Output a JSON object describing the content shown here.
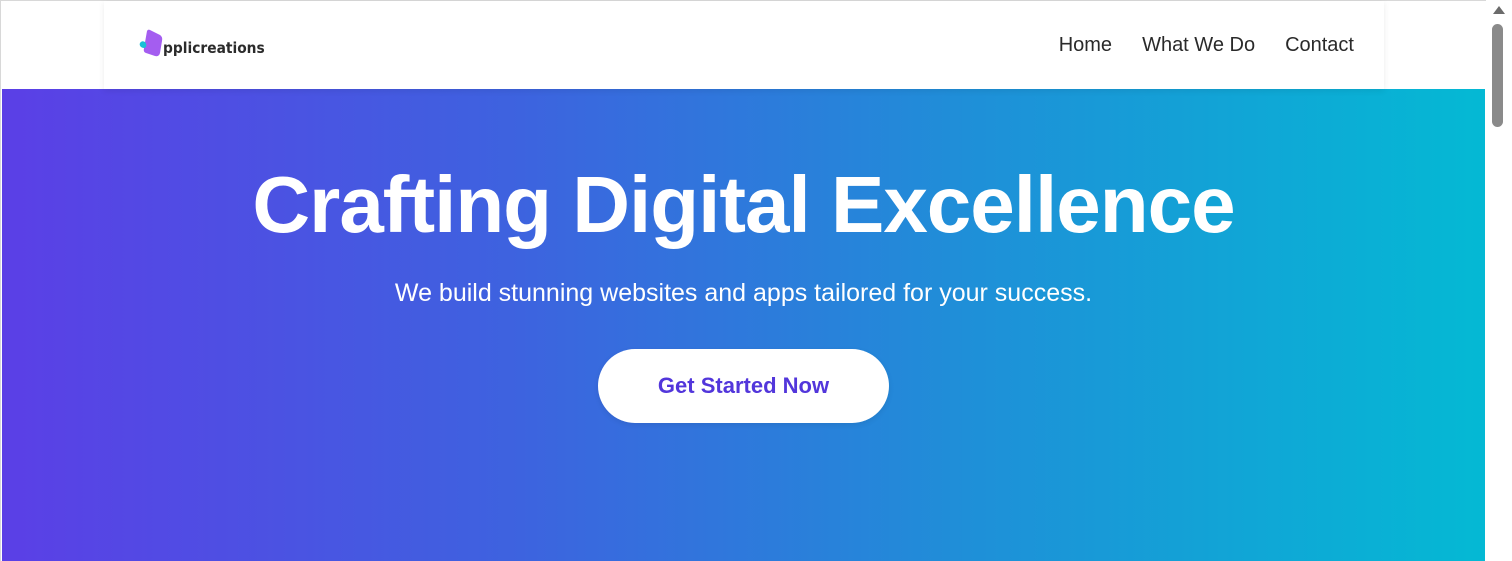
{
  "header": {
    "logo_text": "pplicreations",
    "nav": [
      {
        "label": "Home"
      },
      {
        "label": "What We Do"
      },
      {
        "label": "Contact"
      }
    ]
  },
  "hero": {
    "title": "Crafting Digital Excellence",
    "subtitle": "We build stunning websites and apps tailored for your success.",
    "cta_label": "Get Started Now"
  },
  "colors": {
    "gradient_start": "#5b3fe6",
    "gradient_end": "#04b9d4",
    "cta_text": "#5236db",
    "logo_purple": "#a45df0",
    "logo_teal": "#18c1d6"
  },
  "icons": {
    "logo": "applicreations-logo-icon",
    "scroll_up": "scroll-up-arrow-icon"
  }
}
